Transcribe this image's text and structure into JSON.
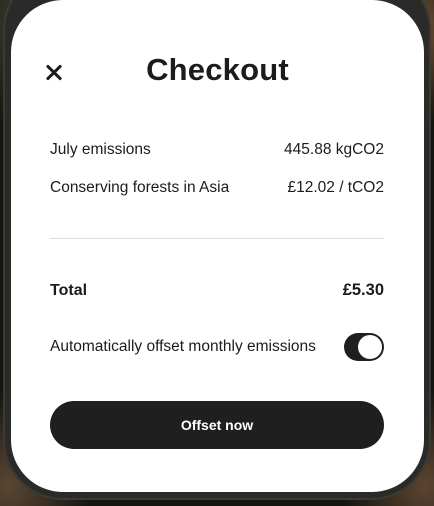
{
  "checkout": {
    "title": "Checkout",
    "close_label": "",
    "line_items": [
      {
        "label": "July emissions",
        "value": "445.88 kgCO2"
      },
      {
        "label": "Conserving forests in Asia",
        "value": "£12.02 / tCO2"
      }
    ],
    "total": {
      "label": "Total",
      "value": "£5.30"
    },
    "auto_offset": {
      "label": "Automatically offset monthly emissions",
      "enabled": true
    },
    "cta_label": "Offset now"
  },
  "colors": {
    "sheet_background": "#ffffff",
    "text": "#1c1c1c",
    "button_background": "#1f1f1f",
    "button_text": "#ffffff",
    "divider": "#dedede"
  },
  "icons": {
    "close": "close-icon"
  }
}
